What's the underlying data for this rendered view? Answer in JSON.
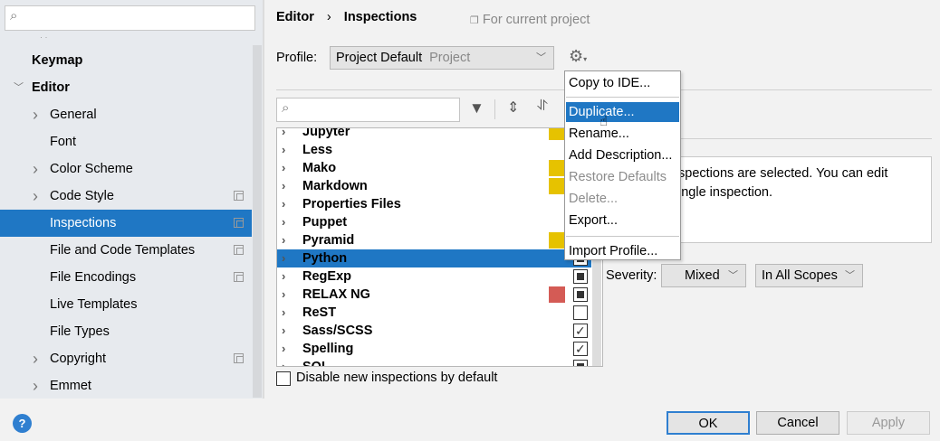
{
  "sidebar": {
    "search_placeholder": "",
    "items": [
      {
        "label": "Keymap",
        "bold": true
      },
      {
        "label": "Editor",
        "bold": true,
        "expanded": true
      },
      {
        "label": "General",
        "expandable": true
      },
      {
        "label": "Font"
      },
      {
        "label": "Color Scheme",
        "expandable": true
      },
      {
        "label": "Code Style",
        "expandable": true,
        "copy": true
      },
      {
        "label": "Inspections",
        "selected": true,
        "copy": true
      },
      {
        "label": "File and Code Templates",
        "copy": true
      },
      {
        "label": "File Encodings",
        "copy": true
      },
      {
        "label": "Live Templates"
      },
      {
        "label": "File Types"
      },
      {
        "label": "Copyright",
        "expandable": true,
        "copy": true
      },
      {
        "label": "Emmet",
        "expandable": true
      }
    ]
  },
  "header": {
    "breadcrumb": [
      "Editor",
      "Inspections"
    ],
    "scope_note": "For current project"
  },
  "profile": {
    "label": "Profile:",
    "value": "Project Default",
    "kind": "Project"
  },
  "list": {
    "rows": [
      {
        "label": "Jupyter",
        "color": "#e6c200",
        "state": "hidden"
      },
      {
        "label": "Less",
        "color": null,
        "state": "hidden"
      },
      {
        "label": "Mako",
        "color": "#e6c200",
        "state": "hidden"
      },
      {
        "label": "Markdown",
        "color": "#e6c200",
        "state": "hidden"
      },
      {
        "label": "Properties Files",
        "color": null,
        "state": "hidden"
      },
      {
        "label": "Puppet",
        "color": null,
        "state": "hidden"
      },
      {
        "label": "Pyramid",
        "color": "#e6c200",
        "state": "hidden"
      },
      {
        "label": "Python",
        "color": null,
        "state": "mixed",
        "selected": true
      },
      {
        "label": "RegExp",
        "color": null,
        "state": "mixed"
      },
      {
        "label": "RELAX NG",
        "color": "#d45b55",
        "state": "mixed"
      },
      {
        "label": "ReST",
        "color": null,
        "state": "unchecked"
      },
      {
        "label": "Sass/SCSS",
        "color": null,
        "state": "checked"
      },
      {
        "label": "Spelling",
        "color": null,
        "state": "checked"
      },
      {
        "label": "SQL",
        "color": null,
        "state": "mixed"
      }
    ]
  },
  "menu": {
    "items": [
      {
        "label": "Copy to IDE..."
      },
      {
        "sep": true
      },
      {
        "label": "Duplicate...",
        "highlighted": true
      },
      {
        "label": "Rename..."
      },
      {
        "label": "Add Description..."
      },
      {
        "label": "Restore Defaults",
        "disabled": true
      },
      {
        "label": "Delete...",
        "disabled": true
      },
      {
        "label": "Export..."
      },
      {
        "sep": true
      },
      {
        "label": "Import Profile..."
      }
    ]
  },
  "description": {
    "line1": "spections are selected. You can edit",
    "line2": "ingle inspection."
  },
  "severity": {
    "label": "Severity:",
    "value": "Mixed",
    "scope": "In All Scopes"
  },
  "disable_new": {
    "label": "Disable new inspections by default",
    "checked": false
  },
  "buttons": {
    "ok": "OK",
    "cancel": "Cancel",
    "apply": "Apply"
  }
}
